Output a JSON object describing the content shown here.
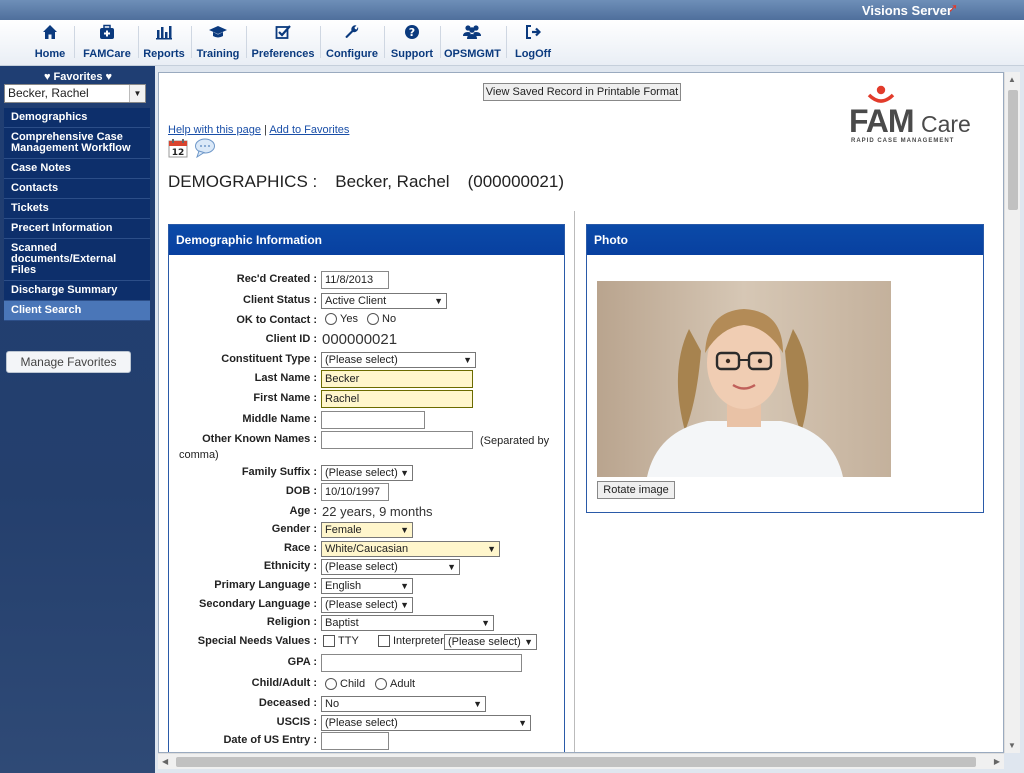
{
  "server_title": "Visions Server",
  "menu": [
    {
      "label": "Home",
      "icon": "home-icon"
    },
    {
      "label": "FAMCare",
      "icon": "medkit-icon"
    },
    {
      "label": "Reports",
      "icon": "bar-chart-icon"
    },
    {
      "label": "Training",
      "icon": "graduation-cap-icon"
    },
    {
      "label": "Preferences",
      "icon": "checkbox-icon"
    },
    {
      "label": "Configure",
      "icon": "wrench-icon"
    },
    {
      "label": "Support",
      "icon": "question-icon"
    },
    {
      "label": "OPSMGMT",
      "icon": "users-icon"
    },
    {
      "label": "LogOff",
      "icon": "sign-out-icon"
    }
  ],
  "sidebar": {
    "favorites_header": "♥ Favorites ♥",
    "selected_client": "Becker, Rachel",
    "items": [
      {
        "label": "Demographics"
      },
      {
        "label": "Comprehensive Case Management Workflow"
      },
      {
        "label": "Case Notes"
      },
      {
        "label": "Contacts"
      },
      {
        "label": "Tickets"
      },
      {
        "label": "Precert Information"
      },
      {
        "label": "Scanned documents/External Files"
      },
      {
        "label": "Discharge Summary"
      },
      {
        "label": "Client Search"
      }
    ],
    "active_index": 8,
    "manage_label": "Manage Favorites"
  },
  "main": {
    "print_button": "View Saved Record in Printable Format",
    "help_link": "Help with this page",
    "favorites_link": "Add to Favorites",
    "link_separator": " | ",
    "calendar_day": "12",
    "heading_section": "DEMOGRAPHICS :",
    "heading_name": "Becker, Rachel",
    "heading_id": "(000000021)"
  },
  "logo": {
    "fam": "FAM",
    "care": "Care",
    "tagline": "RAPID CASE MANAGEMENT",
    "colors": {
      "text": "#4a4a4a",
      "accent": "#e23b2b"
    }
  },
  "demographics": {
    "title": "Demographic Information",
    "labels": {
      "recd_created": "Rec'd Created :",
      "client_status": "Client Status :",
      "ok_contact": "OK to Contact :",
      "client_id": "Client ID :",
      "constituent_type": "Constituent Type :",
      "last_name": "Last Name :",
      "first_name": "First Name :",
      "middle_name": "Middle Name :",
      "other_names": "Other Known Names :",
      "family_suffix": "Family Suffix :",
      "dob": "DOB :",
      "age": "Age :",
      "gender": "Gender :",
      "race": "Race :",
      "ethnicity": "Ethnicity :",
      "primary_language": "Primary Language :",
      "secondary_language": "Secondary Language :",
      "religion": "Religion :",
      "special_needs": "Special Needs Values :",
      "gpa": "GPA :",
      "child_adult": "Child/Adult :",
      "deceased": "Deceased :",
      "uscis": "USCIS :",
      "date_us_entry": "Date of US Entry :"
    },
    "values": {
      "recd_created": "11/8/2013",
      "client_status": "Active Client",
      "ok_yes": "Yes",
      "ok_no": "No",
      "client_id": "000000021",
      "constituent_type": "(Please select)",
      "last_name": "Becker",
      "first_name": "Rachel",
      "middle_name": "",
      "other_names": "",
      "other_names_hint_a": "(Separated by",
      "other_names_hint_b": "comma)",
      "family_suffix": "(Please select)",
      "dob": "10/10/1997",
      "age": "22 years, 9 months",
      "gender": "Female",
      "race": "White/Caucasian",
      "ethnicity": "(Please select)",
      "primary_language": "English",
      "secondary_language": "(Please select)",
      "religion": "Baptist",
      "tty": "TTY",
      "interpreter": "Interpreter",
      "interpreter_select": "(Please select)",
      "gpa": "",
      "child": "Child",
      "adult": "Adult",
      "deceased": "No",
      "uscis": "(Please select)",
      "date_us_entry": ""
    }
  },
  "photo": {
    "title": "Photo",
    "rotate_label": "Rotate image"
  },
  "colors": {
    "nav_blue": "#0d2f6b",
    "active_item": "#4a76b8",
    "section_header": "#0b4aa8",
    "required_field": "#fff6cc",
    "link": "#1a4fa8"
  }
}
